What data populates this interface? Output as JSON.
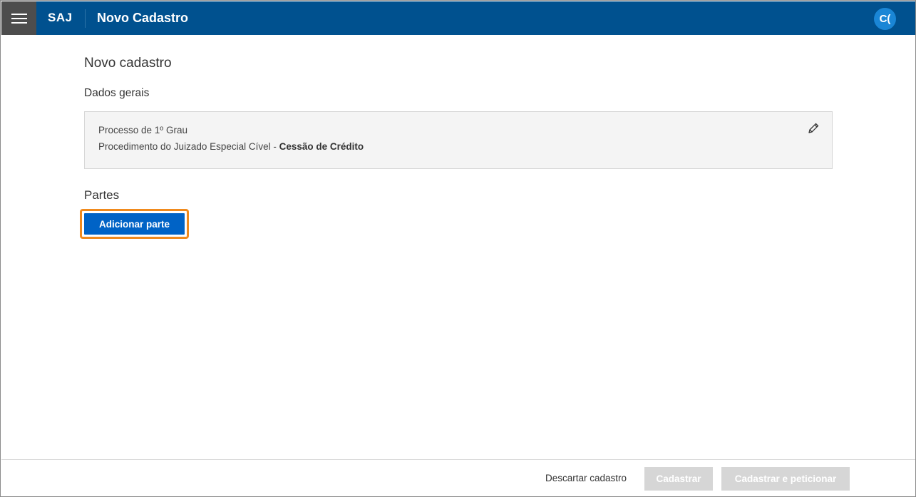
{
  "header": {
    "brand": "SAJ",
    "title": "Novo Cadastro",
    "avatar_initials": "C(",
    "menu_icon": "hamburger-menu-icon",
    "colors": {
      "bar": "#00518f",
      "menu_bg": "#4d4d4d",
      "avatar": "#1a86d6"
    }
  },
  "main": {
    "page_title": "Novo cadastro",
    "dados_gerais": {
      "title": "Dados gerais",
      "line1": "Processo de 1º Grau",
      "line2_prefix": "Procedimento do Juizado Especial Cível - ",
      "line2_bold": "Cessão de Crédito",
      "edit_icon": "pencil-icon"
    },
    "partes": {
      "title": "Partes",
      "add_button": "Adicionar parte"
    }
  },
  "footer": {
    "discard_label": "Descartar cadastro",
    "cadastrar_label": "Cadastrar",
    "cadastrar_peticionar_label": "Cadastrar e peticionar"
  },
  "colors": {
    "primary_button": "#0063c6",
    "highlight": "#f08a1d",
    "disabled_button": "#d6d6d6"
  }
}
